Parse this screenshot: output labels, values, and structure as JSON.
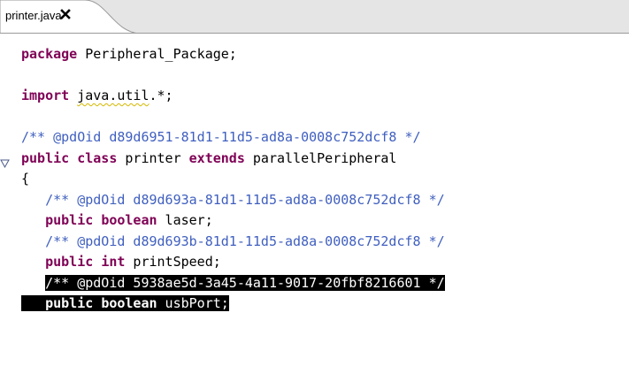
{
  "tab": {
    "title": "printer.java",
    "close_icon": "close-icon"
  },
  "editor": {
    "lines": [
      [
        {
          "t": "kw",
          "s": "package"
        },
        {
          "t": "plain",
          "s": " Peripheral_Package;"
        }
      ],
      [],
      [
        {
          "t": "kw",
          "s": "import"
        },
        {
          "t": "plain",
          "s": " "
        },
        {
          "t": "plain",
          "s": "java.util",
          "squiggle": true
        },
        {
          "t": "plain",
          "s": ".*;"
        }
      ],
      [],
      [
        {
          "t": "cm",
          "s": "/** @pdOid d89d6951-81d1-11d5-ad8a-0008c752dcf8 */"
        }
      ],
      [
        {
          "t": "kw",
          "s": "public"
        },
        {
          "t": "plain",
          "s": " "
        },
        {
          "t": "kw",
          "s": "class"
        },
        {
          "t": "plain",
          "s": " printer "
        },
        {
          "t": "kw",
          "s": "extends"
        },
        {
          "t": "plain",
          "s": " parallelPeripheral"
        }
      ],
      [
        {
          "t": "plain",
          "s": "{"
        }
      ],
      [
        {
          "t": "plain",
          "s": "   "
        },
        {
          "t": "cm",
          "s": "/** @pdOid d89d693a-81d1-11d5-ad8a-0008c752dcf8 */"
        }
      ],
      [
        {
          "t": "plain",
          "s": "   "
        },
        {
          "t": "kw",
          "s": "public"
        },
        {
          "t": "plain",
          "s": " "
        },
        {
          "t": "kw",
          "s": "boolean"
        },
        {
          "t": "plain",
          "s": " laser;"
        }
      ],
      [
        {
          "t": "plain",
          "s": "   "
        },
        {
          "t": "cm",
          "s": "/** @pdOid d89d693b-81d1-11d5-ad8a-0008c752dcf8 */"
        }
      ],
      [
        {
          "t": "plain",
          "s": "   "
        },
        {
          "t": "kw",
          "s": "public"
        },
        {
          "t": "plain",
          "s": " "
        },
        {
          "t": "kw",
          "s": "int"
        },
        {
          "t": "plain",
          "s": " printSpeed;"
        }
      ],
      [
        {
          "t": "plain",
          "s": "   "
        },
        {
          "t": "cm",
          "s": "/** @pdOid 5938ae5d-3a45-4a11-9017-20fbf8216601 */",
          "sel": true
        }
      ],
      [
        {
          "t": "plain",
          "s": "   ",
          "sel": true
        },
        {
          "t": "kw",
          "s": "public",
          "sel": true
        },
        {
          "t": "plain",
          "s": " ",
          "sel": true
        },
        {
          "t": "kw",
          "s": "boolean",
          "sel": true
        },
        {
          "t": "plain",
          "s": " usbPort;",
          "sel": true
        }
      ]
    ],
    "fold_line": 5,
    "fold_icon": "collapse-triangle-icon"
  },
  "colors": {
    "keyword": "#7f0055",
    "comment": "#3f5fbf",
    "selection": "#000000",
    "squiggle": "#d4b800"
  }
}
